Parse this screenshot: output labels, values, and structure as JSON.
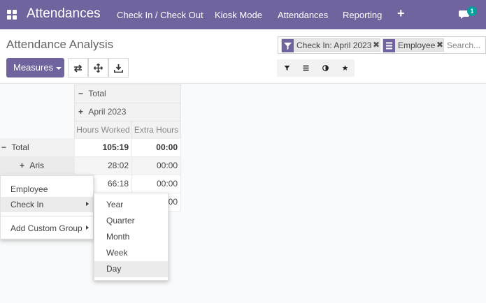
{
  "navbar": {
    "app_title": "Attendances",
    "menu": [
      "Check In / Check Out",
      "Kiosk Mode",
      "Attendances",
      "Reporting"
    ],
    "add_label": "+",
    "chat_badge": "1",
    "color": "#71639e"
  },
  "control": {
    "title": "Attendance Analysis",
    "measures_label": "Measures",
    "facets": [
      {
        "icon": "filter-icon",
        "label": "Check In: April 2023"
      },
      {
        "icon": "groupby-icon",
        "label": "Employee"
      }
    ],
    "search_placeholder": "Search...",
    "accent": "#00a09d"
  },
  "pivot": {
    "col_total": "Total",
    "col_group": "April 2023",
    "measures": [
      "Hours Worked",
      "Extra Hours"
    ],
    "row_total": {
      "label": "Total",
      "values": [
        "105:19",
        "00:00"
      ]
    },
    "rows": [
      {
        "label": "Aris",
        "values": [
          "28:02",
          "00:00"
        ]
      },
      {
        "label": "",
        "values": [
          "66:18",
          "00:00"
        ]
      },
      {
        "label": "",
        "values": [
          "",
          "00"
        ]
      }
    ]
  },
  "groupby_menu": {
    "items": [
      "Employee",
      "Check In",
      "Add Custom Group"
    ]
  },
  "interval_menu": {
    "items": [
      "Year",
      "Quarter",
      "Month",
      "Week",
      "Day"
    ],
    "active": "Day"
  }
}
